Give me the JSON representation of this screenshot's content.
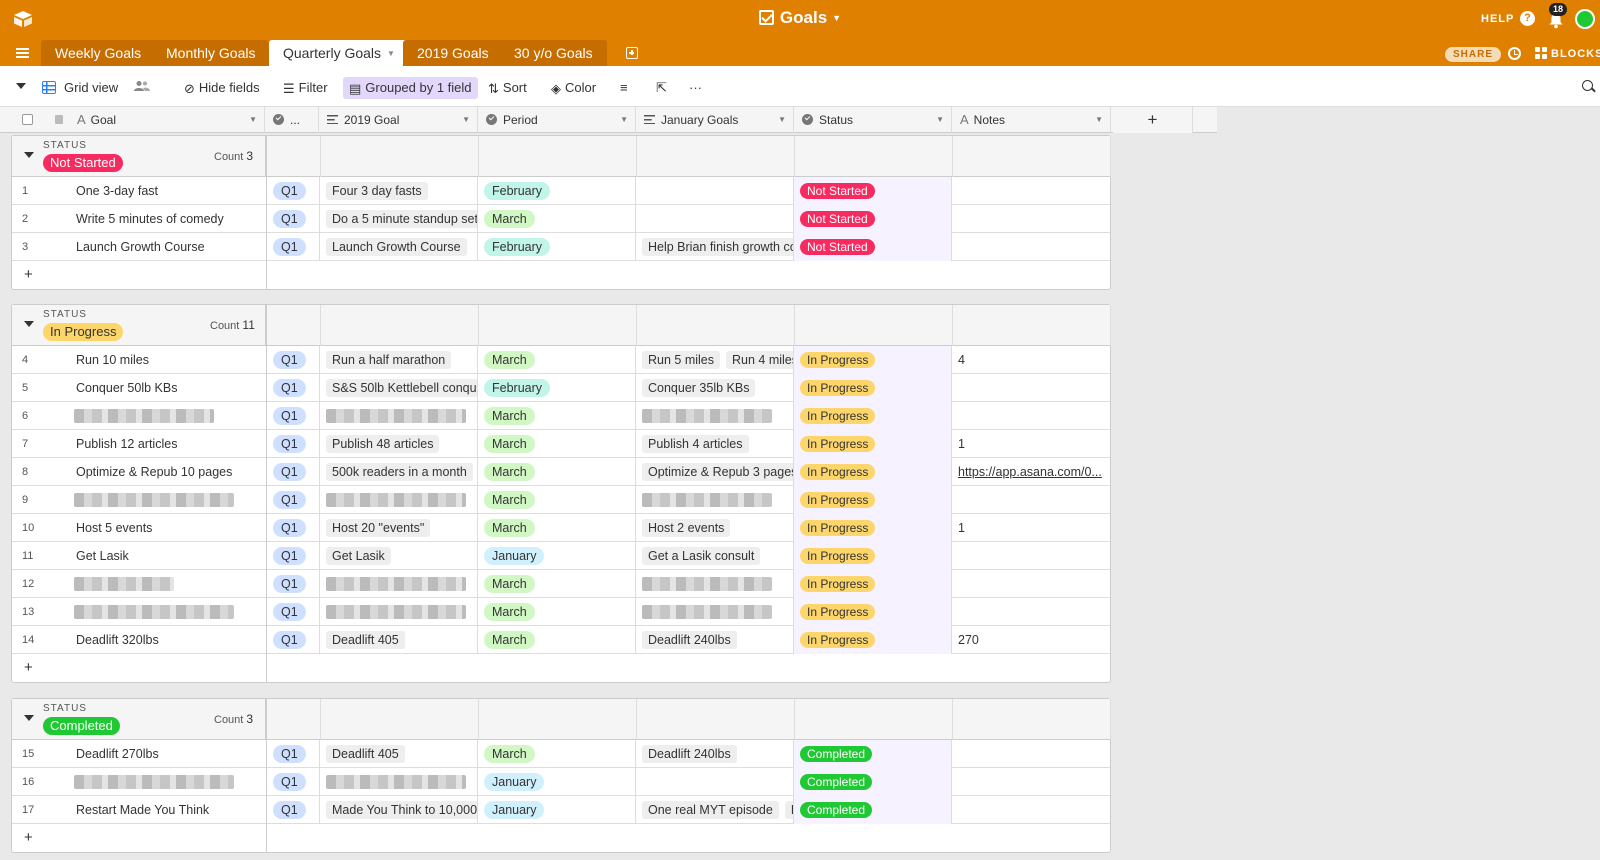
{
  "app": {
    "title": "Goals",
    "help_label": "HELP",
    "notification_count": "18",
    "share_label": "SHARE",
    "blocks_label": "BLOCKS",
    "brand_color": "#e08000"
  },
  "tabs": [
    {
      "label": "Weekly Goals",
      "active": false
    },
    {
      "label": "Monthly Goals",
      "active": false
    },
    {
      "label": "Quarterly Goals",
      "active": true
    },
    {
      "label": "2019 Goals",
      "active": false
    },
    {
      "label": "30 y/o Goals",
      "active": false
    }
  ],
  "toolbar": {
    "view_name": "Grid view",
    "hide_fields": "Hide fields",
    "filter": "Filter",
    "grouped": "Grouped by 1 field",
    "sort": "Sort",
    "color": "Color",
    "more": "···"
  },
  "columns": {
    "goal": "Goal",
    "q": "...",
    "goal2019": "2019 Goal",
    "period": "Period",
    "january": "January Goals",
    "status": "Status",
    "notes": "Notes",
    "add": "+"
  },
  "group_label": "STATUS",
  "count_label": "Count",
  "groups": [
    {
      "name": "Not Started",
      "count": "3",
      "color": "#f82b60",
      "text_color": "#ffffff",
      "rows": [
        {
          "n": "1",
          "goal": "One 3-day fast",
          "q": "Q1",
          "g2019": "Four 3 day fasts",
          "period": "February",
          "jan": [],
          "status": "Not Started",
          "notes": ""
        },
        {
          "n": "2",
          "goal": "Write 5 minutes of comedy",
          "q": "Q1",
          "g2019": "Do a 5 minute standup set",
          "period": "March",
          "jan": [],
          "status": "Not Started",
          "notes": ""
        },
        {
          "n": "3",
          "goal": "Launch Growth Course",
          "q": "Q1",
          "g2019": "Launch Growth Course",
          "period": "February",
          "jan": [
            "Help Brian finish growth co"
          ],
          "status": "Not Started",
          "notes": ""
        }
      ]
    },
    {
      "name": "In Progress",
      "count": "11",
      "color": "#fcd56b",
      "text_color": "#333333",
      "rows": [
        {
          "n": "4",
          "goal": "Run 10 miles",
          "q": "Q1",
          "g2019": "Run a half marathon",
          "period": "March",
          "jan": [
            "Run 5 miles",
            "Run 4 miles"
          ],
          "status": "In Progress",
          "notes": "4"
        },
        {
          "n": "5",
          "goal": "Conquer 50lb KBs",
          "q": "Q1",
          "g2019": "S&S 50lb Kettlebell conque",
          "period": "February",
          "jan": [
            "Conquer 35lb KBs"
          ],
          "status": "In Progress",
          "notes": ""
        },
        {
          "n": "6",
          "goal": "",
          "q": "Q1",
          "g2019": "",
          "period": "March",
          "jan": [],
          "status": "In Progress",
          "notes": "",
          "blurred": true
        },
        {
          "n": "7",
          "goal": "Publish 12 articles",
          "q": "Q1",
          "g2019": "Publish 48 articles",
          "period": "March",
          "jan": [
            "Publish 4 articles"
          ],
          "status": "In Progress",
          "notes": "1"
        },
        {
          "n": "8",
          "goal": "Optimize & Repub 10 pages",
          "q": "Q1",
          "g2019": "500k readers in a month",
          "period": "March",
          "jan": [
            "Optimize & Repub 3 pages"
          ],
          "status": "In Progress",
          "notes": "https://app.asana.com/0...",
          "link": true
        },
        {
          "n": "9",
          "goal": "",
          "q": "Q1",
          "g2019": "",
          "period": "March",
          "jan": [],
          "status": "In Progress",
          "notes": "",
          "blurred": true
        },
        {
          "n": "10",
          "goal": "Host 5 events",
          "q": "Q1",
          "g2019": "Host 20 \"events\"",
          "period": "March",
          "jan": [
            "Host 2 events"
          ],
          "status": "In Progress",
          "notes": "1"
        },
        {
          "n": "11",
          "goal": "Get Lasik",
          "q": "Q1",
          "g2019": "Get Lasik",
          "period": "January",
          "jan": [
            "Get a Lasik consult"
          ],
          "status": "In Progress",
          "notes": ""
        },
        {
          "n": "12",
          "goal": "",
          "q": "Q1",
          "g2019": "",
          "period": "March",
          "jan": [],
          "status": "In Progress",
          "notes": "",
          "blurred": true
        },
        {
          "n": "13",
          "goal": "",
          "q": "Q1",
          "g2019": "",
          "period": "March",
          "jan": [],
          "status": "In Progress",
          "notes": "",
          "blurred": true
        },
        {
          "n": "14",
          "goal": "Deadlift 320lbs",
          "q": "Q1",
          "g2019": "Deadlift 405",
          "period": "March",
          "jan": [
            "Deadlift 240lbs"
          ],
          "status": "In Progress",
          "notes": "270"
        }
      ]
    },
    {
      "name": "Completed",
      "count": "3",
      "color": "#20c933",
      "text_color": "#ffffff",
      "rows": [
        {
          "n": "15",
          "goal": "Deadlift 270lbs",
          "q": "Q1",
          "g2019": "Deadlift 405",
          "period": "March",
          "jan": [
            "Deadlift 240lbs"
          ],
          "status": "Completed",
          "notes": ""
        },
        {
          "n": "16",
          "goal": "",
          "q": "Q1",
          "g2019": "",
          "period": "January",
          "jan": [],
          "status": "Completed",
          "notes": "",
          "blurred": true
        },
        {
          "n": "17",
          "goal": "Restart Made You Think",
          "q": "Q1",
          "g2019": "Made You Think to 10,000 ,",
          "period": "January",
          "jan": [
            "One real MYT episode",
            "Rec"
          ],
          "status": "Completed",
          "notes": ""
        }
      ]
    }
  ],
  "month_colors": {
    "January": "#d0f0fd",
    "February": "#c2f5e9",
    "March": "#d1f7c4"
  }
}
